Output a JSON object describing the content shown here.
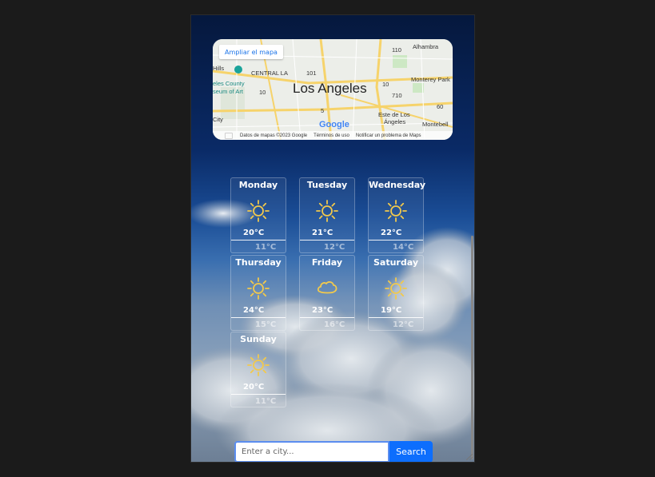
{
  "map": {
    "enlarge_label": "Ampliar el mapa",
    "city_label": "Los Angeles",
    "labels": {
      "alhambra": "Alhambra",
      "central_la": "CENTRAL LA",
      "hills": "Hills",
      "museum_line1": "eles County",
      "museum_line2": "seum of Art",
      "monterey_park": "Monterey Park",
      "city": "City",
      "este1": "Este de Los",
      "este2": "Ángeles",
      "montebello": "Montebell",
      "r101": "101",
      "r10a": "10",
      "r110": "110",
      "r710": "710",
      "r5": "5",
      "r60": "60",
      "r10b": "10"
    },
    "logo": "Google",
    "footer": {
      "data": "Datos de mapas ©2023 Google",
      "terms": "Términos de uso",
      "report": "Notificar un problema de Maps"
    }
  },
  "forecast": [
    {
      "day": "Monday",
      "high": "20°C",
      "low": "11°C",
      "icon": "sun-icon"
    },
    {
      "day": "Tuesday",
      "high": "21°C",
      "low": "12°C",
      "icon": "sun-icon"
    },
    {
      "day": "Wednesday",
      "high": "22°C",
      "low": "14°C",
      "icon": "sun-icon"
    },
    {
      "day": "Thursday",
      "high": "24°C",
      "low": "15°C",
      "icon": "sun-icon"
    },
    {
      "day": "Friday",
      "high": "23°C",
      "low": "16°C",
      "icon": "cloud-icon"
    },
    {
      "day": "Saturday",
      "high": "19°C",
      "low": "12°C",
      "icon": "sun-icon"
    },
    {
      "day": "Sunday",
      "high": "20°C",
      "low": "11°C",
      "icon": "sun-icon"
    }
  ],
  "colors": {
    "icon": "#f2c94c",
    "accent": "#0d6efd"
  },
  "search": {
    "placeholder": "Enter a city...",
    "button_label": "Search"
  }
}
